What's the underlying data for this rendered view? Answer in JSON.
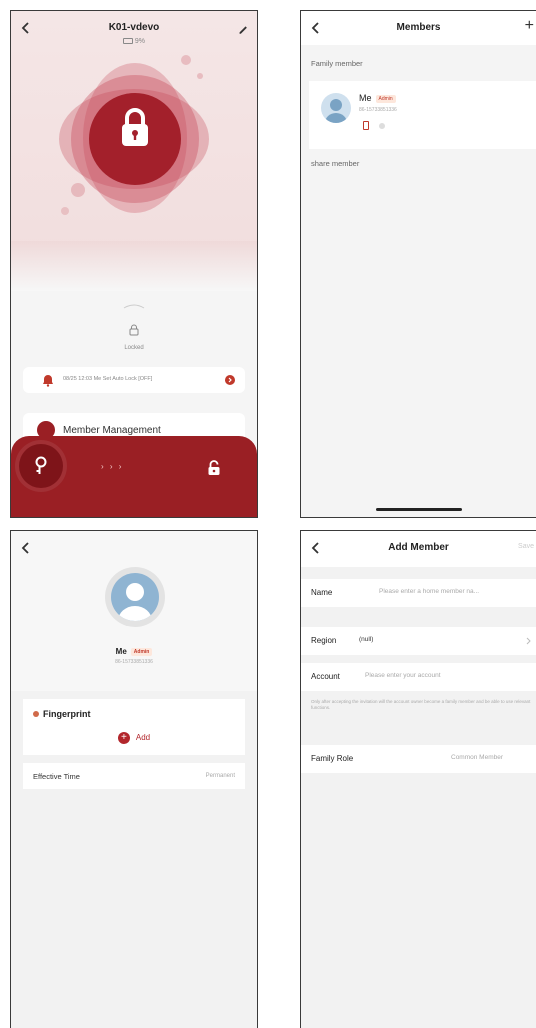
{
  "lock_screen": {
    "title": "K01-vdevo",
    "battery_text": "9%",
    "status": "Locked",
    "log_text": "08/25 12:03 Me  Set Auto Lock  [OFF]",
    "member_management_label": "Member Management",
    "slide_hint": "› › ›",
    "accent_color": "#9a1f24"
  },
  "members_screen": {
    "title": "Members",
    "add_icon": "+",
    "family_section": "Family member",
    "share_section": "share member",
    "member": {
      "name": "Me",
      "role": "Admin",
      "account": "86-15733851336"
    }
  },
  "member_detail_screen": {
    "name": "Me",
    "role": "Admin",
    "account": "86-15733851336",
    "fingerprint_label": "Fingerprint",
    "add_label": "Add",
    "effective_time_label": "Effective Time",
    "effective_time_value": "Permanent"
  },
  "add_member_screen": {
    "title": "Add Member",
    "save_label": "Save",
    "name_label": "Name",
    "name_placeholder": "Please enter a home member na...",
    "region_label": "Region",
    "region_value": "(null)",
    "account_label": "Account",
    "account_placeholder": "Please enter your account",
    "note": "Only after accepting the invitation will the account owner become a family member and be able to use relevant functions.",
    "family_role_label": "Family Role",
    "family_role_value": "Common Member"
  }
}
